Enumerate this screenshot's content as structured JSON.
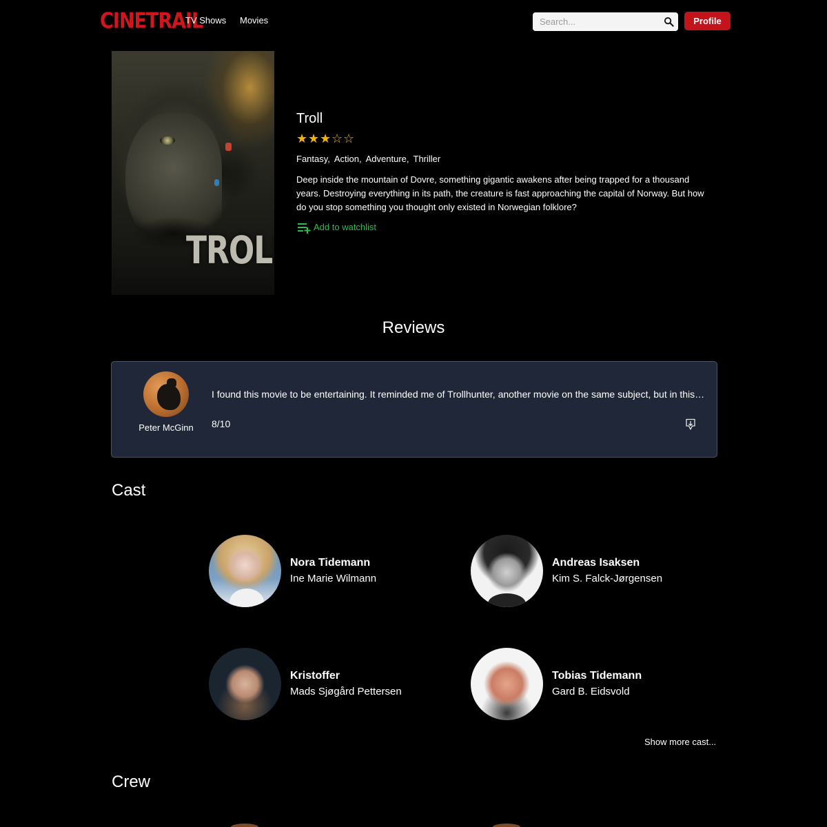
{
  "nav": {
    "logo": "CINETRAIL",
    "links": [
      "TV Shows",
      "Movies"
    ],
    "search_placeholder": "Search...",
    "profile_label": "Profile"
  },
  "movie": {
    "poster_title": "TROLL",
    "title": "Troll",
    "rating_stars": 3,
    "rating_max": 5,
    "genres": [
      "Fantasy,",
      "Action,",
      "Adventure,",
      "Thriller"
    ],
    "overview": "Deep inside the mountain of Dovre, something gigantic awakens after being trapped for a thousand years. Destroying everything in its path, the creature is fast approaching the capital of Norway. But how do you stop something you thought only existed in Norwegian folklore?",
    "watchlist_label": "Add to watchlist"
  },
  "reviews": {
    "heading": "Reviews",
    "items": [
      {
        "author": "Peter McGinn",
        "text": "I found this movie to be entertaining. It reminded me of Trollhunter, another movie on the same subject, but in this one the troll is much larger and the action spreads across the country.",
        "score": "8/10"
      }
    ]
  },
  "cast": {
    "heading": "Cast",
    "members": [
      {
        "name": "Nora Tidemann",
        "actor": "Ine Marie Wilmann"
      },
      {
        "name": "Andreas Isaksen",
        "actor": "Kim S. Falck-Jørgensen"
      },
      {
        "name": "Kristoffer",
        "actor": "Mads Sjøgård Pettersen"
      },
      {
        "name": "Tobias Tidemann",
        "actor": "Gard B. Eidsvold"
      }
    ],
    "show_more_label": "Show more cast..."
  },
  "crew": {
    "heading": "Crew"
  },
  "colors": {
    "brand": "#d0161c",
    "star": "#f5b400",
    "watchlist": "#2fbf4a",
    "review_card": "#1f2738"
  }
}
